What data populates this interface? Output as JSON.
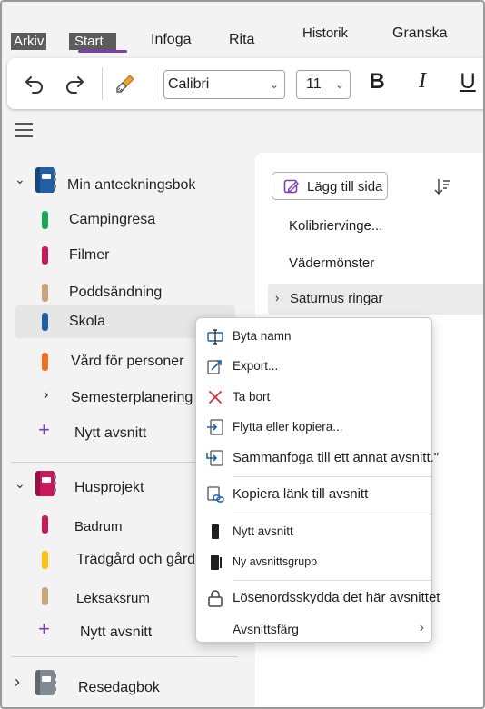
{
  "ribbon": {
    "tabs": {
      "arkiv": "Arkiv",
      "start": "Start",
      "infoga": "Infoga",
      "rita": "Rita",
      "historik": "Historik",
      "granska": "Granska"
    }
  },
  "toolbar": {
    "font_name": "Calibri",
    "font_size": "11",
    "bold_label": "B",
    "italic_label": "I",
    "underline_label": "U"
  },
  "notebooks": [
    {
      "name": "Min anteckningsbok",
      "color": "#1e5fa8",
      "expanded": true,
      "sections": [
        {
          "label": "Campingresa",
          "color": "#1aaa55"
        },
        {
          "label": "Filmer",
          "color": "#c8185c"
        },
        {
          "label": "Poddsändning",
          "color": "#c8a47c"
        },
        {
          "label": "Skola",
          "color": "#1e5fa8",
          "selected": true
        },
        {
          "label": "Vård för personer",
          "color": "#f07020"
        },
        {
          "label": "Semesterplanering",
          "group": true
        }
      ],
      "new_section": "Nytt avsnitt"
    },
    {
      "name": "Husprojekt",
      "color": "#c8185c",
      "expanded": true,
      "sections": [
        {
          "label": "Badrum",
          "color": "#c8185c"
        },
        {
          "label": "Trädgård och gård",
          "color": "#ffc20e"
        },
        {
          "label": "Leksaksrum",
          "color": "#c8a47c"
        }
      ],
      "new_section": "Nytt avsnitt"
    },
    {
      "name": "Resedagbok",
      "color": "#7f8a94",
      "expanded": false
    }
  ],
  "pages_pane": {
    "add_page": "Lägg till sida",
    "pages": [
      "Kolibriervinge...",
      "Vädermönster",
      "Saturnus ringar"
    ]
  },
  "context_menu": {
    "items": [
      {
        "label": "Byta namn",
        "icon": "rename-icon"
      },
      {
        "label": "Export...",
        "icon": "export-icon"
      },
      {
        "label": "Ta bort",
        "icon": "delete-icon"
      },
      {
        "label": "Flytta eller kopiera...",
        "icon": "move-icon"
      },
      {
        "label": "Sammanfoga till ett annat avsnitt.\"",
        "icon": "merge-icon"
      },
      {
        "label": "Kopiera länk till avsnitt",
        "icon": "link-icon"
      },
      {
        "label": "Nytt avsnitt",
        "icon": "new-section-icon"
      },
      {
        "label": "Ny avsnittsgrupp",
        "icon": "new-section-group-icon"
      },
      {
        "label": "Lösenordsskydda det här avsnittet",
        "icon": "lock-icon"
      },
      {
        "label": "Avsnittsfärg",
        "icon": "color-icon"
      }
    ]
  },
  "colors": {
    "accent": "#7b3fb0",
    "delete_red": "#d13438",
    "icon_blue": "#1e5fa8"
  }
}
